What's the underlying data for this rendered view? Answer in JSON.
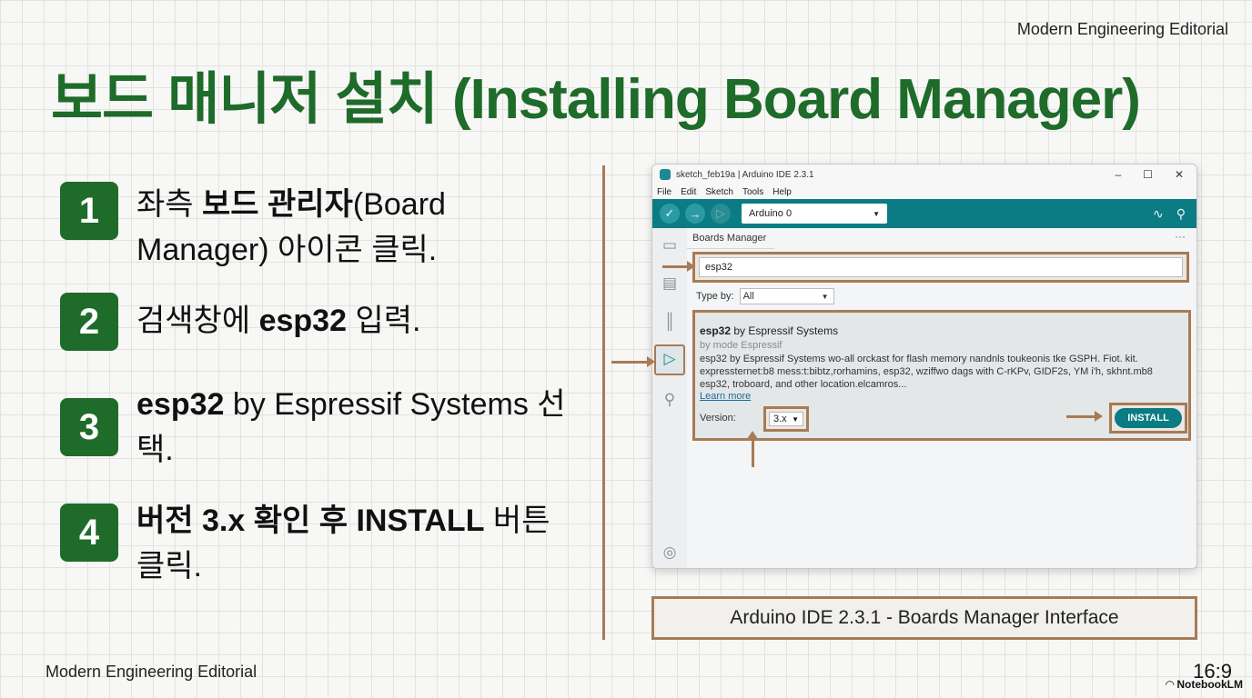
{
  "header": {
    "brand_top": "Modern Engineering Editorial",
    "title": "보드 매니저 설치 (Installing Board Manager)"
  },
  "steps": [
    {
      "num": "1",
      "pre": "좌측 ",
      "bold": "보드 관리자",
      "post": "(Board Manager) 아이콘 클릭."
    },
    {
      "num": "2",
      "pre": "검색창에 ",
      "bold": "esp32",
      "post": " 입력."
    },
    {
      "num": "3",
      "pre": "",
      "bold": "esp32",
      "post": " by Espressif Systems 선택."
    },
    {
      "num": "4",
      "pre": "",
      "bold": "버전 3.x 확인 후 INSTALL",
      "post": " 버튼 클릭."
    }
  ],
  "ide": {
    "window_title": "sketch_feb19a | Arduino IDE 2.3.1",
    "win_controls": {
      "minimize": "–",
      "maximize": "☐",
      "close": "✕"
    },
    "menu": [
      "File",
      "Edit",
      "Sketch",
      "Tools",
      "Help"
    ],
    "board_select": "Arduino 0",
    "panel_title": "Boards Manager",
    "panel_more": "···",
    "search_value": "esp32",
    "type_label": "Type by:",
    "type_value": "All",
    "card": {
      "name": "esp32",
      "name_suffix": " by Espressif Systems",
      "by": "by mode Espressif",
      "description": "esp32 by Espressif Systems wo-all orckast for flash memory nandnls toukeonis tke GSPH. Fiot. kit. expressternet:b8 mess:t:bibtz,rorhamins, esp32, wziffwo dags with C-rKPv, GIDF2s, YM i'h, skhnt.mb8 esp32, troboard, and other location.elcamros...",
      "learn_more": "Learn more",
      "version_label": "Version:",
      "version_value": "3.x",
      "install_label": "INSTALL"
    }
  },
  "caption": "Arduino IDE 2.3.1 - Boards Manager Interface",
  "footer": {
    "brand_bottom": "Modern Engineering Editorial",
    "ratio": "16:9",
    "notebook": "NotebookLM"
  },
  "colors": {
    "accent_green": "#1e6b2a",
    "arduino_teal": "#0b7c84",
    "highlight_bronze": "#a77b55"
  }
}
